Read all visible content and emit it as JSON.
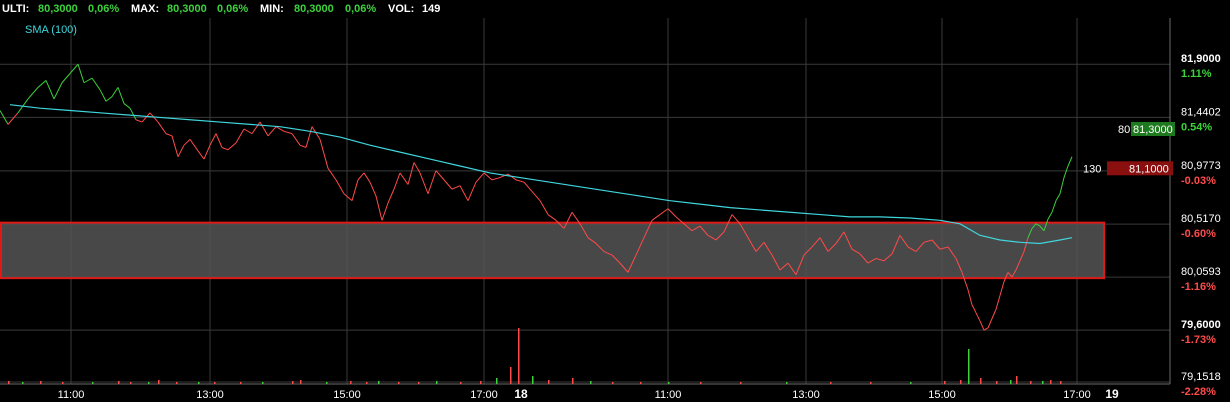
{
  "header": {
    "last_label": "ULTI:",
    "last_value": "80,3000",
    "last_pct": "0,06%",
    "max_label": "MAX:",
    "max_value": "80,3000",
    "max_pct": "0,06%",
    "min_label": "MIN:",
    "min_value": "80,3000",
    "min_pct": "0,06%",
    "vol_label": "VOL:",
    "vol_value": "149"
  },
  "colors": {
    "up": "#3cd23c",
    "down": "#ff4a4a",
    "sma": "#3fd6dc",
    "grid": "#3a3a3a",
    "zone_fill": "#555555",
    "zone_border": "#e01818",
    "ask_tag": "#1e7a1e",
    "bid_tag": "#8a1010"
  },
  "chart_data": {
    "type": "line",
    "title": "",
    "xlabel": "",
    "ylabel": "",
    "ylim": [
      79.1518,
      82.3
    ],
    "x_ticks": [
      "11:00",
      "13:00",
      "15:00",
      "17:00",
      "18",
      "11:00",
      "13:00",
      "15:00",
      "17:00",
      "19"
    ],
    "x_tick_pos": [
      71,
      210,
      347,
      484,
      521,
      668,
      806,
      942,
      1077,
      1112
    ],
    "x_tick_bold": [
      false,
      false,
      false,
      false,
      true,
      false,
      false,
      false,
      false,
      true
    ],
    "x_range": [
      0,
      1100
    ],
    "y_ticks": [
      {
        "value": 81.9,
        "label": "81,9000",
        "pct": "1.11%",
        "pct_color": "#3cd23c",
        "bold": true
      },
      {
        "value": 81.4402,
        "label": "81,4402",
        "pct": "0.54%",
        "pct_color": "#3cd23c",
        "bold": false
      },
      {
        "value": 80.9773,
        "label": "80,9773",
        "pct": "-0.03%",
        "pct_color": "#ff4a4a",
        "bold": false
      },
      {
        "value": 80.517,
        "label": "80,5170",
        "pct": "-0.60%",
        "pct_color": "#ff4a4a",
        "bold": false
      },
      {
        "value": 80.0593,
        "label": "80,0593",
        "pct": "-1.16%",
        "pct_color": "#ff4a4a",
        "bold": false
      },
      {
        "value": 79.6,
        "label": "79,6000",
        "pct": "-1.73%",
        "pct_color": "#ff4a4a",
        "bold": true
      },
      {
        "value": 79.1518,
        "label": "79,1518",
        "pct": "-2.28%",
        "pct_color": "#ff4a4a",
        "bold": false
      }
    ],
    "series": [
      {
        "name": "",
        "kind": "price",
        "x": [
          0,
          8,
          18,
          28,
          38,
          46,
          54,
          62,
          70,
          78,
          84,
          92,
          100,
          106,
          112,
          118,
          124,
          130,
          136,
          142,
          150,
          158,
          166,
          172,
          178,
          184,
          190,
          198,
          204,
          210,
          216,
          222,
          228,
          236,
          244,
          252,
          260,
          268,
          276,
          284,
          292,
          300,
          306,
          312,
          320,
          328,
          336,
          344,
          352,
          358,
          364,
          370,
          376,
          382,
          388,
          394,
          400,
          408,
          414,
          420,
          428,
          436,
          444,
          452,
          460,
          468,
          476,
          484,
          492,
          500,
          508,
          516,
          524,
          532,
          540,
          548,
          556,
          564,
          572,
          580,
          588,
          596,
          604,
          612,
          620,
          628,
          636,
          644,
          652,
          660,
          668,
          676,
          684,
          692,
          700,
          708,
          716,
          724,
          732,
          740,
          748,
          756,
          764,
          772,
          780,
          788,
          796,
          804,
          812,
          820,
          828,
          836,
          844,
          852,
          860,
          868,
          876,
          884,
          892,
          900,
          908,
          916,
          924,
          932,
          940,
          948,
          956,
          962,
          968,
          972,
          976,
          980,
          984,
          988,
          992,
          996,
          1000,
          1004,
          1008,
          1012,
          1016,
          1020,
          1024,
          1028,
          1032,
          1036,
          1040,
          1044,
          1048,
          1052,
          1056,
          1060,
          1064,
          1068,
          1072
        ],
        "y": [
          81.5,
          81.38,
          81.48,
          81.6,
          81.7,
          81.76,
          81.6,
          81.74,
          81.82,
          81.9,
          81.74,
          81.78,
          81.68,
          81.58,
          81.62,
          81.7,
          81.56,
          81.52,
          81.42,
          81.4,
          81.48,
          81.4,
          81.3,
          81.28,
          81.1,
          81.2,
          81.25,
          81.15,
          81.08,
          81.2,
          81.3,
          81.18,
          81.16,
          81.22,
          81.34,
          81.3,
          81.4,
          81.28,
          81.36,
          81.32,
          81.3,
          81.2,
          81.18,
          81.36,
          81.25,
          81.0,
          80.9,
          80.78,
          80.72,
          80.9,
          80.96,
          80.88,
          80.76,
          80.55,
          80.7,
          80.82,
          80.96,
          80.86,
          81.05,
          80.96,
          80.78,
          80.98,
          80.9,
          80.82,
          80.85,
          80.72,
          80.88,
          80.96,
          80.9,
          80.92,
          80.95,
          80.9,
          80.88,
          80.8,
          80.72,
          80.6,
          80.55,
          80.48,
          80.62,
          80.52,
          80.4,
          80.35,
          80.28,
          80.25,
          80.18,
          80.1,
          80.25,
          80.4,
          80.55,
          80.6,
          80.65,
          80.58,
          80.52,
          80.46,
          80.5,
          80.42,
          80.38,
          80.45,
          80.6,
          80.52,
          80.4,
          80.28,
          80.36,
          80.25,
          80.12,
          80.18,
          80.08,
          80.25,
          80.32,
          80.4,
          80.28,
          80.35,
          80.45,
          80.3,
          80.26,
          80.18,
          80.22,
          80.2,
          80.26,
          80.42,
          80.32,
          80.28,
          80.36,
          80.38,
          80.3,
          80.32,
          80.22,
          80.1,
          79.95,
          79.82,
          79.75,
          79.68,
          79.6,
          79.62,
          79.7,
          79.78,
          79.9,
          80.02,
          80.1,
          80.06,
          80.12,
          80.2,
          80.28,
          80.4,
          80.48,
          80.52,
          80.5,
          80.46,
          80.56,
          80.62,
          80.72,
          80.78,
          80.92,
          81.02,
          81.1
        ]
      },
      {
        "name": "SMA (100)",
        "kind": "sma",
        "x": [
          10,
          40,
          70,
          100,
          130,
          160,
          190,
          220,
          250,
          280,
          310,
          340,
          370,
          400,
          430,
          460,
          490,
          520,
          550,
          580,
          610,
          640,
          670,
          700,
          730,
          760,
          790,
          820,
          850,
          880,
          910,
          940,
          960,
          980,
          1000,
          1020,
          1040,
          1060,
          1072
        ],
        "y": [
          81.55,
          81.52,
          81.5,
          81.48,
          81.46,
          81.44,
          81.42,
          81.4,
          81.38,
          81.36,
          81.32,
          81.27,
          81.2,
          81.14,
          81.08,
          81.02,
          80.96,
          80.92,
          80.88,
          80.84,
          80.8,
          80.76,
          80.72,
          80.69,
          80.66,
          80.64,
          80.62,
          80.6,
          80.58,
          80.58,
          80.57,
          80.55,
          80.52,
          80.42,
          80.38,
          80.36,
          80.35,
          80.38,
          80.4
        ]
      }
    ],
    "volume": {
      "x": [
        8,
        22,
        40,
        62,
        92,
        118,
        130,
        148,
        158,
        176,
        198,
        214,
        240,
        262,
        292,
        300,
        326,
        350,
        366,
        378,
        398,
        418,
        436,
        460,
        480,
        496,
        510,
        518,
        532,
        548,
        572,
        590,
        612,
        640,
        668,
        700,
        740,
        786,
        830,
        870,
        910,
        944,
        960,
        968,
        980,
        996,
        1010,
        1016,
        1030,
        1042,
        1050,
        1060
      ],
      "v": [
        3,
        2,
        3,
        2,
        2,
        3,
        2,
        2,
        4,
        2,
        2,
        2,
        2,
        2,
        3,
        4,
        2,
        3,
        2,
        3,
        2,
        2,
        3,
        2,
        3,
        6,
        17,
        56,
        8,
        4,
        6,
        3,
        2,
        2,
        2,
        2,
        2,
        2,
        2,
        2,
        2,
        3,
        4,
        35,
        6,
        3,
        4,
        8,
        3,
        3,
        4,
        3
      ]
    },
    "support_zone": {
      "y_high": 80.53,
      "y_low": 80.05
    },
    "quote_tags": {
      "ask_left": "80",
      "ask_value": "81,3000",
      "ask_level": 81.34,
      "bid_left": "130",
      "bid_value": "81,1000",
      "bid_level": 81.0
    }
  }
}
